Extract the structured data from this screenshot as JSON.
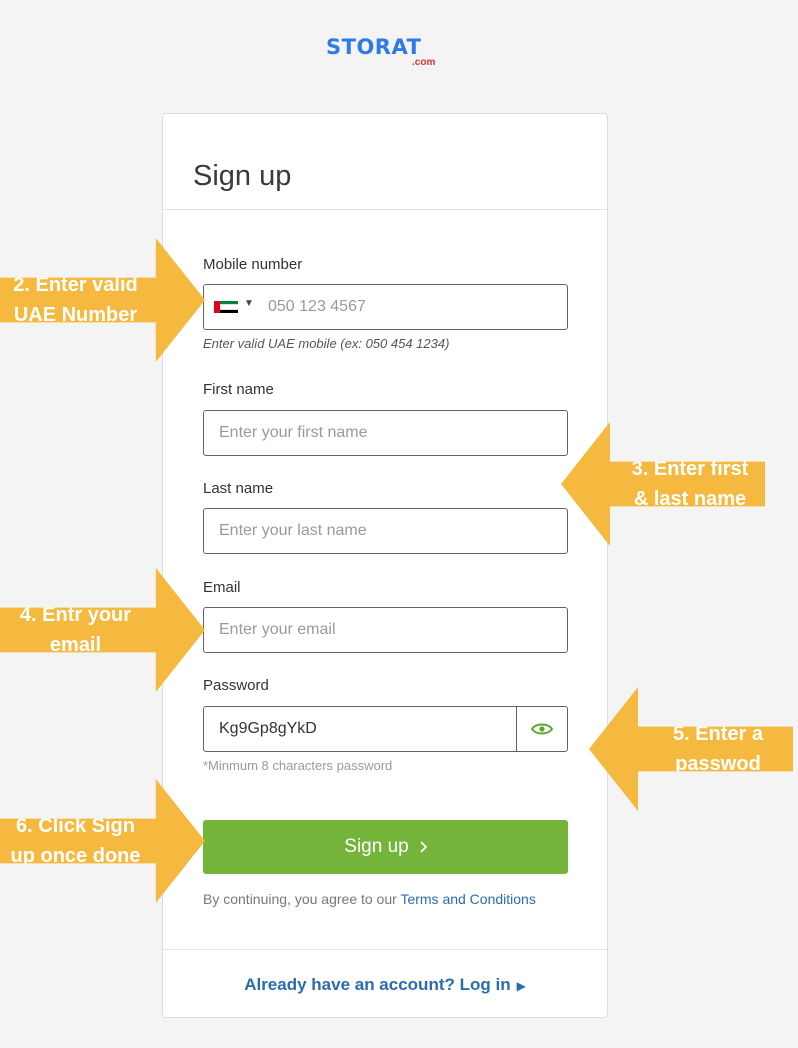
{
  "logo": {
    "main": "STORAT",
    "sub": ".com"
  },
  "form": {
    "title": "Sign up",
    "mobile": {
      "label": "Mobile number",
      "country": "UAE",
      "placeholder": "050 123 4567",
      "hint": "Enter valid UAE mobile (ex: 050 454 1234)"
    },
    "first_name": {
      "label": "First name",
      "placeholder": "Enter your first name"
    },
    "last_name": {
      "label": "Last name",
      "placeholder": "Enter your last name"
    },
    "email": {
      "label": "Email",
      "placeholder": "Enter your email"
    },
    "password": {
      "label": "Password",
      "value": "Kg9Gp8gYkD",
      "hint": "*Minmum 8 characters password"
    },
    "submit_label": "Sign up",
    "agree_text": "By continuing, you agree to our",
    "terms_link": "Terms and Conditions",
    "login_text": "Already have an account? Log in"
  },
  "callouts": {
    "step2": {
      "line1": "2. Enter valid",
      "line2": "UAE Number"
    },
    "step3": {
      "line1": "3. Enter first",
      "line2": "& last name"
    },
    "step4": {
      "line1": "4. Entr your",
      "line2": "email"
    },
    "step5": {
      "line1": "5. Enter a",
      "line2": "passwod"
    },
    "step6": {
      "line1": "6. Click Sign",
      "line2": "up once done"
    }
  },
  "colors": {
    "brand_blue": "#2f7be6",
    "accent_green": "#74b43a",
    "callout_yellow": "#f4b93e",
    "link_blue": "#2b6cb0"
  },
  "icons": {
    "password_toggle": "eye-icon",
    "login_arrow": "triangle-right-icon",
    "submit_arrow": "chevron-right-icon"
  }
}
